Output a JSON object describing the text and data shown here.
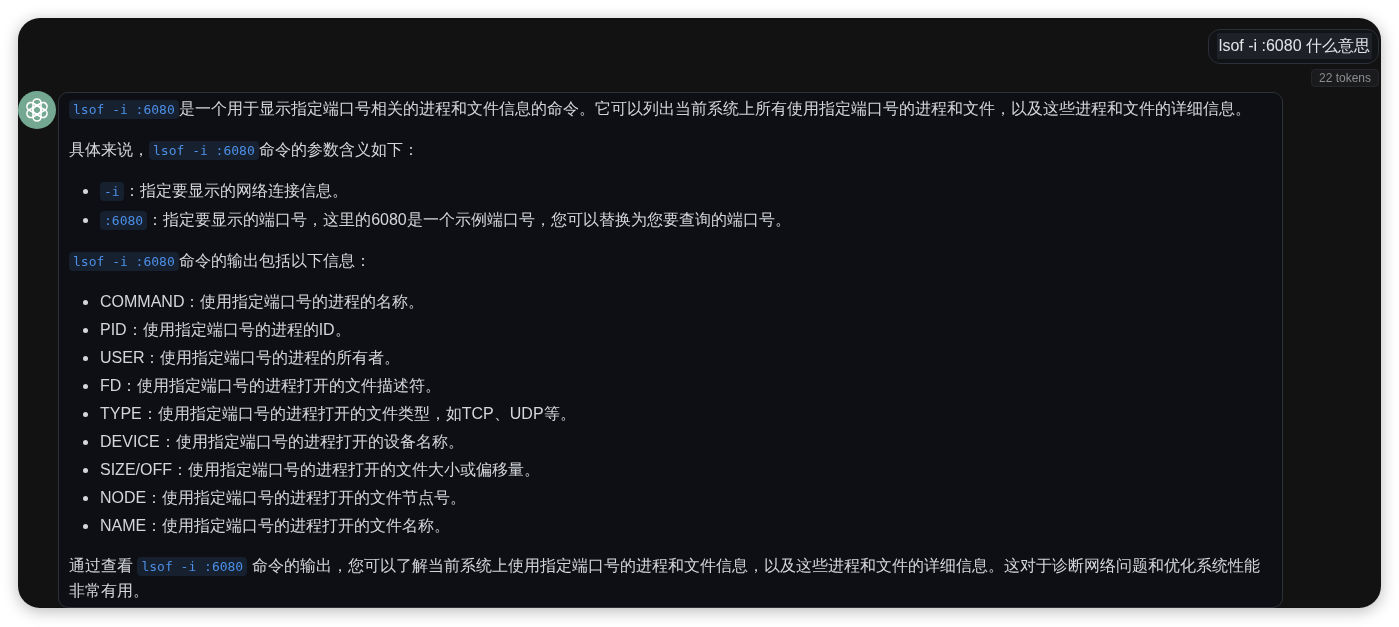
{
  "user_message": {
    "text": "lsof -i :6080 什么意思",
    "token_count": "22 tokens"
  },
  "assistant_message": {
    "blocks": [
      {
        "kind": "paragraph",
        "parts": [
          {
            "kind": "code",
            "text": "lsof -i :6080"
          },
          {
            "kind": "text",
            "text": "是一个用于显示指定端口号相关的进程和文件信息的命令。它可以列出当前系统上所有使用指定端口号的进程和文件，以及这些进程和文件的详细信息。"
          }
        ]
      },
      {
        "kind": "paragraph",
        "parts": [
          {
            "kind": "text",
            "text": "具体来说，"
          },
          {
            "kind": "code",
            "text": "lsof -i :6080"
          },
          {
            "kind": "text",
            "text": "命令的参数含义如下："
          }
        ]
      },
      {
        "kind": "list",
        "items": [
          {
            "parts": [
              {
                "kind": "code",
                "text": "-i"
              },
              {
                "kind": "text",
                "text": "：指定要显示的网络连接信息。"
              }
            ]
          },
          {
            "parts": [
              {
                "kind": "code",
                "text": ":6080"
              },
              {
                "kind": "text",
                "text": "：指定要显示的端口号，这里的6080是一个示例端口号，您可以替换为您要查询的端口号。"
              }
            ]
          }
        ]
      },
      {
        "kind": "paragraph",
        "parts": [
          {
            "kind": "code",
            "text": "lsof -i :6080"
          },
          {
            "kind": "text",
            "text": "命令的输出包括以下信息："
          }
        ]
      },
      {
        "kind": "list",
        "items": [
          {
            "parts": [
              {
                "kind": "text",
                "text": "COMMAND：使用指定端口号的进程的名称。"
              }
            ]
          },
          {
            "parts": [
              {
                "kind": "text",
                "text": "PID：使用指定端口号的进程的ID。"
              }
            ]
          },
          {
            "parts": [
              {
                "kind": "text",
                "text": "USER：使用指定端口号的进程的所有者。"
              }
            ]
          },
          {
            "parts": [
              {
                "kind": "text",
                "text": "FD：使用指定端口号的进程打开的文件描述符。"
              }
            ]
          },
          {
            "parts": [
              {
                "kind": "text",
                "text": "TYPE：使用指定端口号的进程打开的文件类型，如TCP、UDP等。"
              }
            ]
          },
          {
            "parts": [
              {
                "kind": "text",
                "text": "DEVICE：使用指定端口号的进程打开的设备名称。"
              }
            ]
          },
          {
            "parts": [
              {
                "kind": "text",
                "text": "SIZE/OFF：使用指定端口号的进程打开的文件大小或偏移量。"
              }
            ]
          },
          {
            "parts": [
              {
                "kind": "text",
                "text": "NODE：使用指定端口号的进程打开的文件节点号。"
              }
            ]
          },
          {
            "parts": [
              {
                "kind": "text",
                "text": "NAME：使用指定端口号的进程打开的文件名称。"
              }
            ]
          }
        ]
      },
      {
        "kind": "paragraph",
        "parts": [
          {
            "kind": "text",
            "text": "通过查看 "
          },
          {
            "kind": "code",
            "text": "lsof -i :6080"
          },
          {
            "kind": "text",
            "text": " 命令的输出，您可以了解当前系统上使用指定端口号的进程和文件信息，以及这些进程和文件的详细信息。这对于诊断网络问题和优化系统性能非常有用。"
          }
        ]
      }
    ]
  }
}
